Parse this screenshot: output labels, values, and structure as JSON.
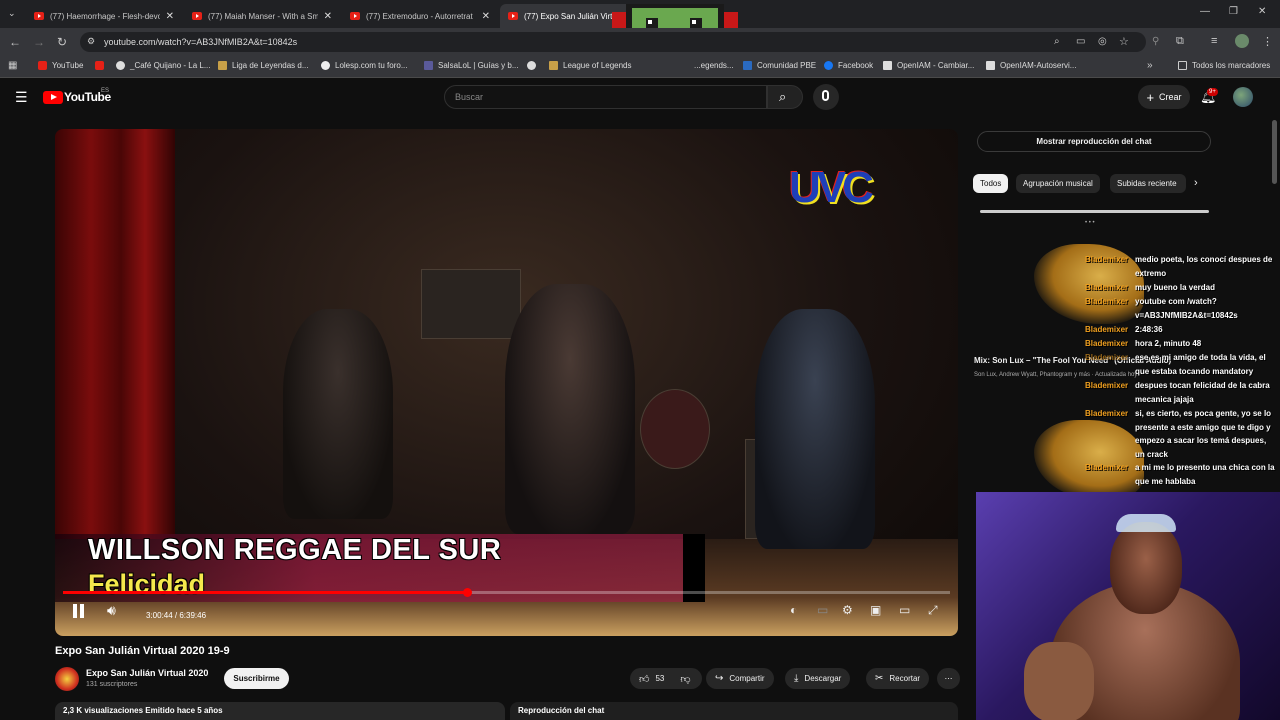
{
  "browser": {
    "tabs": [
      {
        "title": "(77) Haemorrhage - Flesh-devo"
      },
      {
        "title": "(77) Maiah Manser - With a Sm"
      },
      {
        "title": "(77) Extremoduro - Autorretrat"
      },
      {
        "title": "(77) Expo San Julián Virtu"
      }
    ],
    "url": "youtube.com/watch?v=AB3JNfMIB2A&t=10842s",
    "bookmarks": [
      "YouTube",
      "_Café Quijano - La L...",
      "Liga de Leyendas d...",
      "Lolesp.com tu foro...",
      "SalsaLoL | Guías y b...",
      "League of Legends",
      "...egends...",
      "Comunidad PBE",
      "Facebook",
      "OpenIAM - Cambiar...",
      "OpenIAM-Autoservi..."
    ],
    "bookmarks_all": "Todos los marcadores"
  },
  "youtube": {
    "logo": "YouTube",
    "country": "ES",
    "search_placeholder": "Buscar",
    "create_label": "Crear",
    "notifications_count": "9+"
  },
  "video": {
    "overlay_channel_logo": "UVC",
    "artist": "WILLSON REGGAE DEL SUR",
    "song": "Felicidad",
    "time": "3:00:44 / 6:39:46",
    "progress": 0.455,
    "title": "Expo San Julián Virtual 2020 19-9",
    "channel": "Expo San Julián Virtual 2020",
    "subscribers": "131 suscriptores",
    "subscribe_label": "Suscribirme",
    "likes": "53",
    "share_label": "Compartir",
    "download_label": "Descargar",
    "clip_label": "Recortar",
    "views": "2,3 K visualizaciones  Emitido hace 5 años",
    "chat_replay_bottom": "Reproducción del chat"
  },
  "sidebar": {
    "chat_replay_button": "Mostrar reproducción del chat",
    "chips": [
      "Todos",
      "Agrupación musical",
      "Subidas reciente"
    ],
    "mix_title": "Mix: Son Lux – \"The Fool You Need\" (Official Audio)",
    "mix_subtitle": "Son Lux, Andrew Wyatt, Phantogram y más · Actualizada hoy"
  },
  "stream_chat": [
    {
      "author": "Blademixer",
      "text": "medio poeta, los conocí despues de extremo"
    },
    {
      "author": "Blademixer",
      "text": "muy bueno la verdad"
    },
    {
      "author": "Blademixer",
      "text": "youtube com /watch? v=AB3JNfMIB2A&t=10842s"
    },
    {
      "author": "Blademixer",
      "text": "2:48:36"
    },
    {
      "author": "Blademixer",
      "text": "hora 2, minuto 48"
    },
    {
      "author": "Blademixer",
      "text": "ese es mi amigo de toda la vida, el que estaba tocando mandatory"
    },
    {
      "author": "Blademixer",
      "text": "despues tocan felicidad de la cabra mecanica jajaja"
    },
    {
      "author": "Blademixer",
      "text": "si, es cierto, es poca gente, yo se lo presente a este amigo que te digo y empezo a sacar los temá despues, un crack"
    },
    {
      "author": "Blademixer",
      "text": "a mi me lo presento una chica con la que me hablaba"
    }
  ],
  "colors": {
    "accent_red": "#ff0000",
    "chat_author": "#f0a020",
    "song_yellow": "#f5e84c"
  }
}
